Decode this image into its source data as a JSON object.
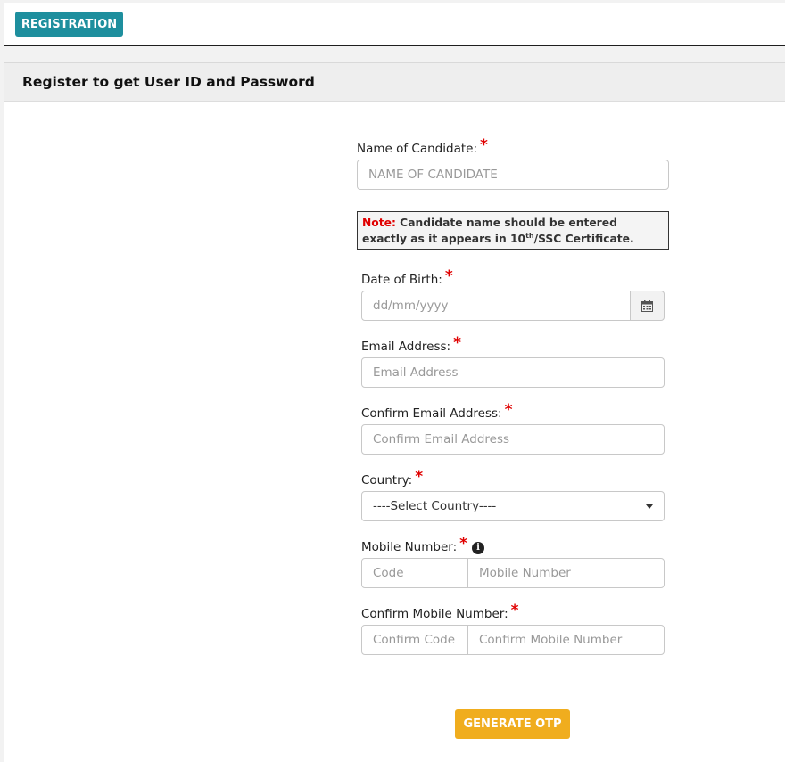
{
  "topbar": {
    "registration_label": "REGISTRATION"
  },
  "panel": {
    "title": "Register to get User ID and Password"
  },
  "form": {
    "candidate_name": {
      "label": "Name of Candidate:",
      "required_mark": "*",
      "placeholder": "NAME OF CANDIDATE"
    },
    "note": {
      "key": "Note:",
      "text_before_sup": "Candidate name should be entered exactly as it appears in 10",
      "sup": "th",
      "text_after_sup": "/SSC Certificate."
    },
    "dob": {
      "label": "Date of Birth:",
      "required_mark": "*",
      "placeholder": "dd/mm/yyyy",
      "icon": "calendar-icon"
    },
    "email": {
      "label": "Email Address:",
      "required_mark": "*",
      "placeholder": "Email Address"
    },
    "confirm_email": {
      "label": "Confirm Email Address:",
      "required_mark": "*",
      "placeholder": "Confirm Email Address"
    },
    "country": {
      "label": "Country:",
      "required_mark": "*",
      "selected": "----Select Country----"
    },
    "mobile": {
      "label": "Mobile Number:",
      "required_mark": "*",
      "info_icon": "i",
      "code_placeholder": "Code",
      "number_placeholder": "Mobile Number"
    },
    "confirm_mobile": {
      "label": "Confirm Mobile Number:",
      "required_mark": "*",
      "code_placeholder": "Confirm Code",
      "number_placeholder": "Confirm Mobile Number"
    },
    "submit_label": "GENERATE OTP"
  },
  "colors": {
    "primary_teal": "#1e8f9e",
    "otp_button": "#f0ad1e",
    "required_red": "#e00000"
  }
}
